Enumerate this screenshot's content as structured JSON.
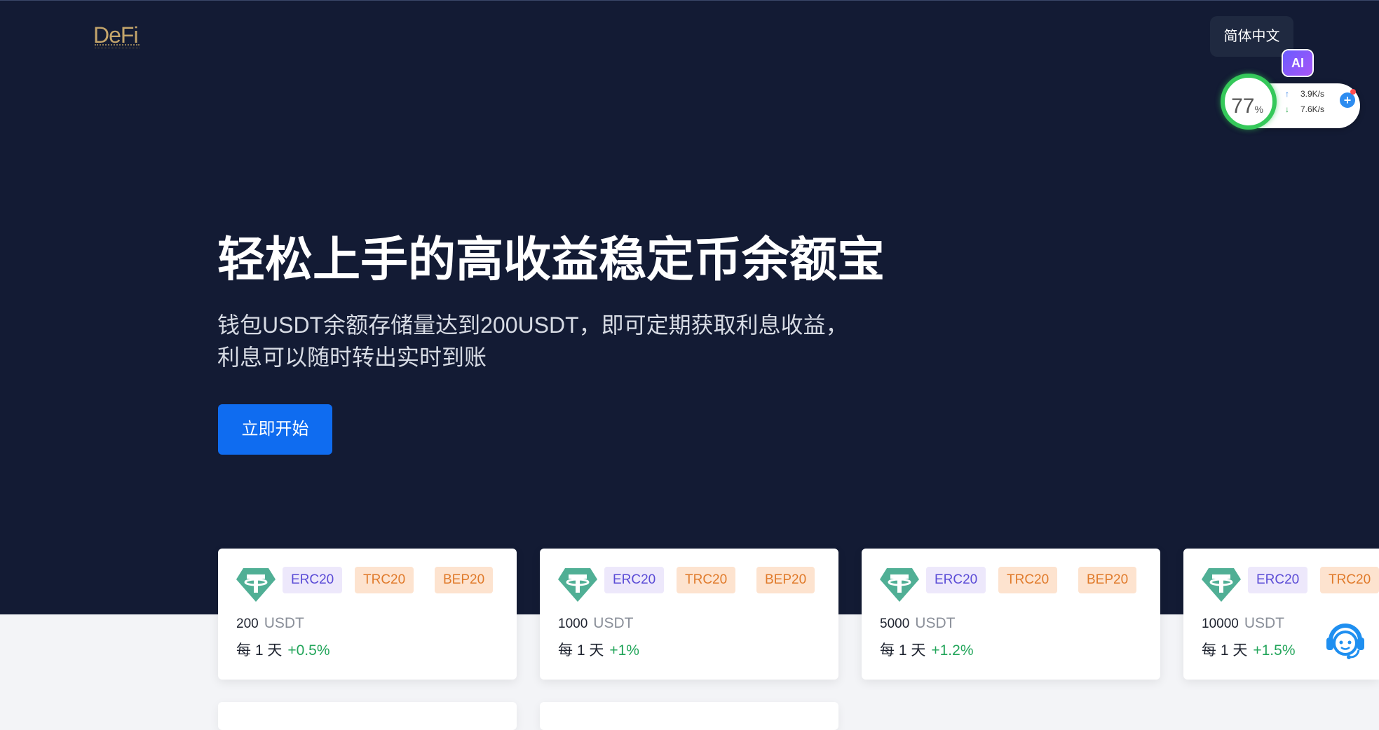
{
  "brand": {
    "logo": "DeFi"
  },
  "header": {
    "language": "简体中文"
  },
  "overlay": {
    "ai_badge": "AI",
    "cpu_percent": "77",
    "percent_sign": "%",
    "upload": "3.9K/s",
    "download": "7.6K/s"
  },
  "hero": {
    "title": "轻松上手的高收益稳定币余额宝",
    "subtitle_line1": "钱包USDT余额存储量达到200USDT，即可定期获取利息收益，",
    "subtitle_line2": "利息可以随时转出实时到账",
    "cta": "立即开始"
  },
  "cards": [
    {
      "chips": [
        "ERC20",
        "TRC20",
        "BEP20"
      ],
      "amount": "200",
      "unit": "USDT",
      "period": "每 1 天",
      "rate": "+0.5%"
    },
    {
      "chips": [
        "ERC20",
        "TRC20",
        "BEP20"
      ],
      "amount": "1000",
      "unit": "USDT",
      "period": "每 1 天",
      "rate": "+1%"
    },
    {
      "chips": [
        "ERC20",
        "TRC20",
        "BEP20"
      ],
      "amount": "5000",
      "unit": "USDT",
      "period": "每 1 天",
      "rate": "+1.2%"
    },
    {
      "chips": [
        "ERC20",
        "TRC20"
      ],
      "amount": "10000",
      "unit": "USDT",
      "period": "每 1 天",
      "rate": "+1.5%"
    }
  ],
  "colors": {
    "hero_bg": "#131b34",
    "primary": "#0f6cf0",
    "positive": "#22a55a",
    "tether_green": "#50af95"
  },
  "icons": {
    "token": "tether-icon",
    "support": "customer-service-icon"
  }
}
